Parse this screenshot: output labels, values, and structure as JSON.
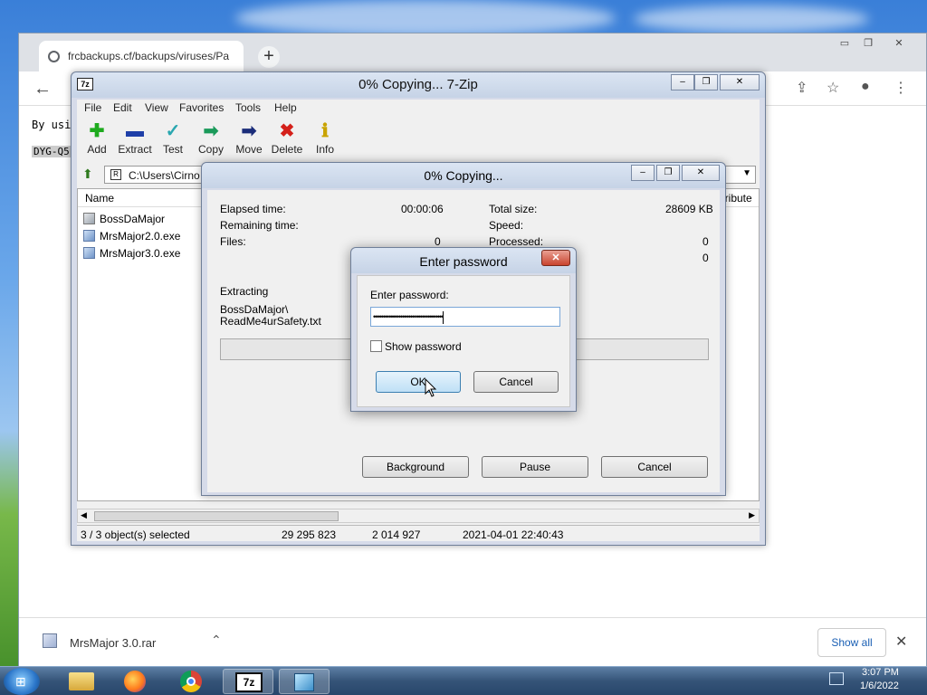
{
  "chrome": {
    "tab_title": "frcbackups.cf/backups/viruses/Pa",
    "new_tab_label": "+",
    "content_line1": "By usi",
    "content_line2": "DYG-Q5",
    "download_file": "MrsMajor 3.0.rar",
    "show_all_label": "Show all"
  },
  "zip": {
    "title": "0% Copying... 7-Zip",
    "menu": [
      "File",
      "Edit",
      "View",
      "Favorites",
      "Tools",
      "Help"
    ],
    "toolbar": [
      "Add",
      "Extract",
      "Test",
      "Copy",
      "Move",
      "Delete",
      "Info"
    ],
    "path": "C:\\Users\\Cirno",
    "columns": {
      "name": "Name",
      "attributes": "ttribute"
    },
    "files": [
      "BossDaMajor",
      "MrsMajor2.0.exe",
      "MrsMajor3.0.exe"
    ],
    "status": {
      "selected": "3 / 3 object(s) selected",
      "size": "29 295 823",
      "packed": "2 014 927",
      "modified": "2021-04-01 22:40:43"
    }
  },
  "copy": {
    "title": "0% Copying...",
    "elapsed_label": "Elapsed time:",
    "elapsed_value": "00:00:06",
    "remaining_label": "Remaining time:",
    "files_label": "Files:",
    "files_value": "0",
    "total_label": "Total size:",
    "total_value": "28609 KB",
    "speed_label": "Speed:",
    "processed_label": "Processed:",
    "processed_value": "0",
    "row4_value": "0",
    "extracting_label": "Extracting",
    "extracting_path1": "BossDaMajor\\",
    "extracting_path2": "ReadMe4urSafety.txt",
    "background_label": "Background",
    "pause_label": "Pause",
    "cancel_label": "Cancel"
  },
  "password": {
    "title": "Enter password",
    "field_label": "Enter password:",
    "masked_value": "••••••••••••••••••••••••••••••••••••",
    "show_password_label": "Show password",
    "ok_label": "OK",
    "cancel_label": "Cancel"
  },
  "taskbar": {
    "time": "3:07 PM",
    "date": "1/6/2022"
  }
}
